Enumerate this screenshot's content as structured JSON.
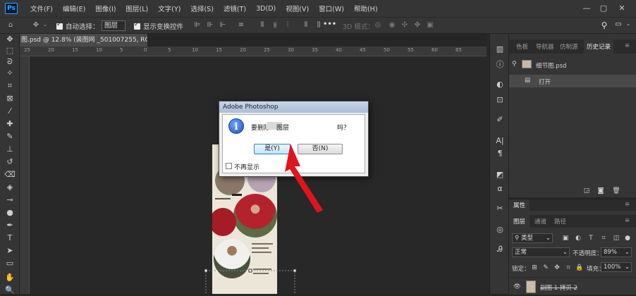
{
  "app": {
    "logo": "Ps"
  },
  "menu": [
    "文件(F)",
    "编辑(E)",
    "图像(I)",
    "图层(L)",
    "文字(Y)",
    "选择(S)",
    "滤镜(T)",
    "3D(D)",
    "视图(V)",
    "窗口(W)",
    "帮助(H)"
  ],
  "options": {
    "auto_select_label": "自动选择：",
    "auto_select_value": "图层",
    "transform_controls_label": "显示变换控件",
    "mode_3d_label": "3D 模式："
  },
  "document": {
    "tab_title": "图.psd @ 12.8% (装图网 _501007255, RGB/8) *",
    "ruler_ticks": [
      "25",
      "20",
      "15",
      "10",
      "5",
      "0",
      "5",
      "10",
      "15",
      "20",
      "25",
      "30",
      "35",
      "40",
      "45",
      "50",
      "55",
      "60",
      "65"
    ]
  },
  "dialog": {
    "title": "Adobe Photoshop",
    "message_prefix": "要删除",
    "message_suffix": "图层",
    "message_end": "吗？",
    "yes_label": "是(Y)",
    "no_label": "否(N)",
    "dont_show_label": "不再显示"
  },
  "history_panel": {
    "tabs": [
      "色板",
      "导航器",
      "仿制源",
      "历史记录"
    ],
    "snapshot_name": "细节图.psd",
    "items": [
      "打开"
    ]
  },
  "layers_panel": {
    "collapsed_tab": "属性",
    "tabs": [
      "图层",
      "通道",
      "路径"
    ],
    "filter_label": "类型",
    "blend_mode": "正常",
    "opacity_label": "不透明度：",
    "opacity_value": "89%",
    "lock_label": "锁定：",
    "fill_label": "填充：",
    "fill_value": "100%",
    "layer_name": "副图 1 拷贝 2"
  },
  "colors": {
    "accent": "#31a8ff",
    "arrow": "#e0141c",
    "panel": "#353535",
    "canvas": "#282828"
  }
}
